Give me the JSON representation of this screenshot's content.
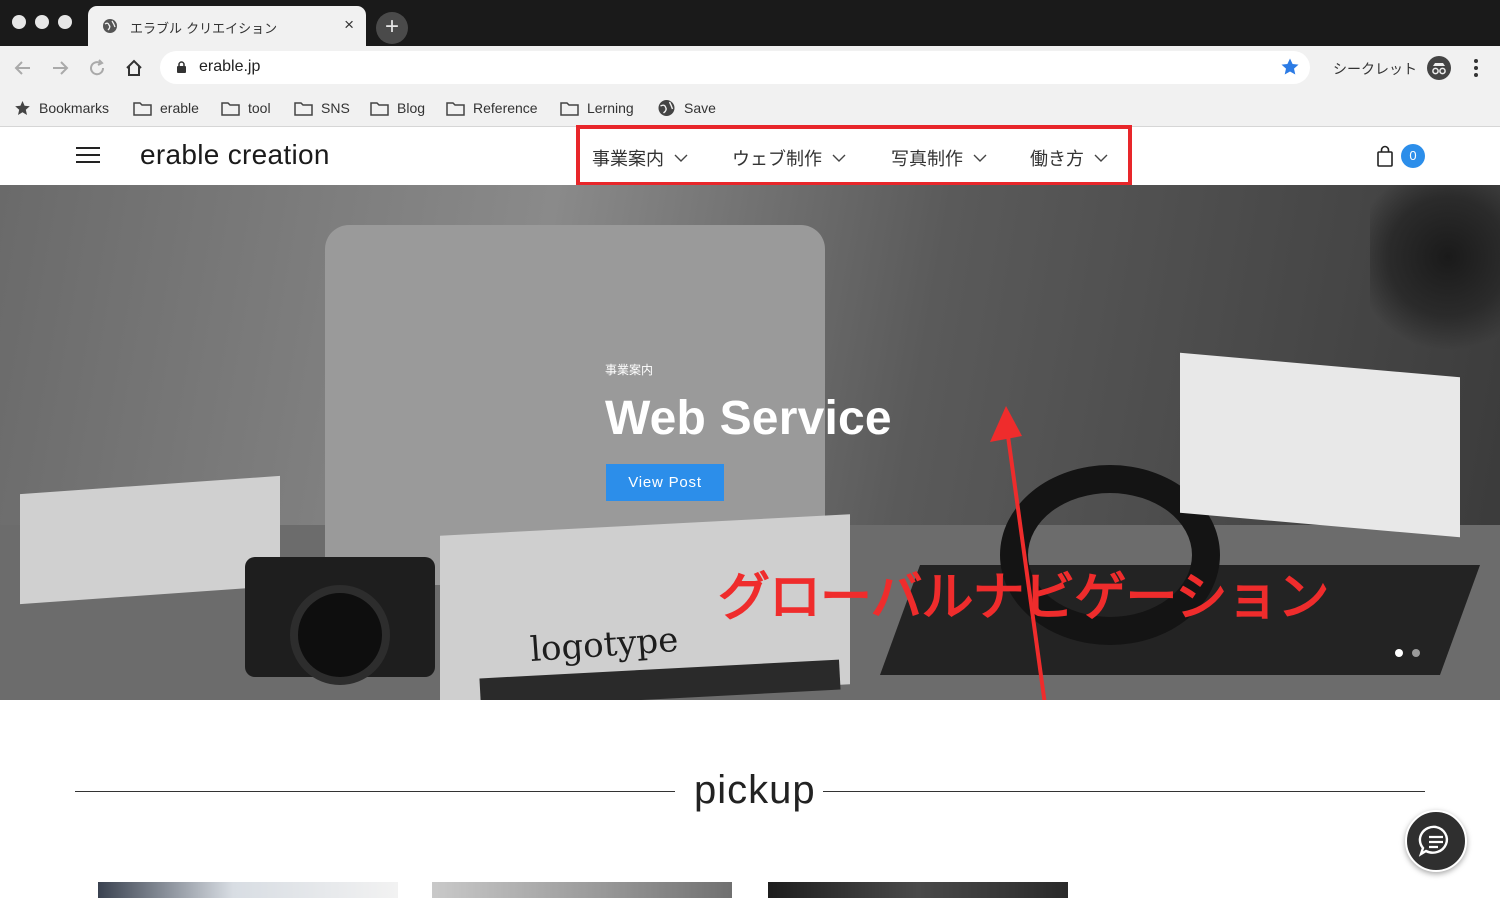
{
  "browser": {
    "tab_title": "エラブル クリエイション",
    "tab_close": "×",
    "new_tab": "+",
    "url": "erable.jp",
    "incognito_label": "シークレット",
    "bookmarks": [
      {
        "label": "Bookmarks",
        "icon": "star-icon"
      },
      {
        "label": "erable",
        "icon": "folder-icon"
      },
      {
        "label": "tool",
        "icon": "folder-icon"
      },
      {
        "label": "SNS",
        "icon": "folder-icon"
      },
      {
        "label": "Blog",
        "icon": "folder-icon"
      },
      {
        "label": "Reference",
        "icon": "folder-icon"
      },
      {
        "label": "Lerning",
        "icon": "folder-icon"
      },
      {
        "label": "Save",
        "icon": "globe-icon"
      }
    ]
  },
  "site": {
    "logo": "erable creation",
    "global_nav": [
      {
        "label": "事業案内"
      },
      {
        "label": "ウェブ制作"
      },
      {
        "label": "写真制作"
      },
      {
        "label": "働き方"
      }
    ],
    "cart_count": "0",
    "accent_color": "#2c8eea"
  },
  "hero": {
    "eyebrow": "事業案内",
    "title": "Web Service",
    "button": "View Post",
    "photo_text_logotype": "logotype",
    "annotation": "グローバルナビゲーション",
    "annotation_color": "#ef2c2c",
    "slides_total": 2,
    "slide_active": 1
  },
  "pickup": {
    "heading": "pickup"
  }
}
